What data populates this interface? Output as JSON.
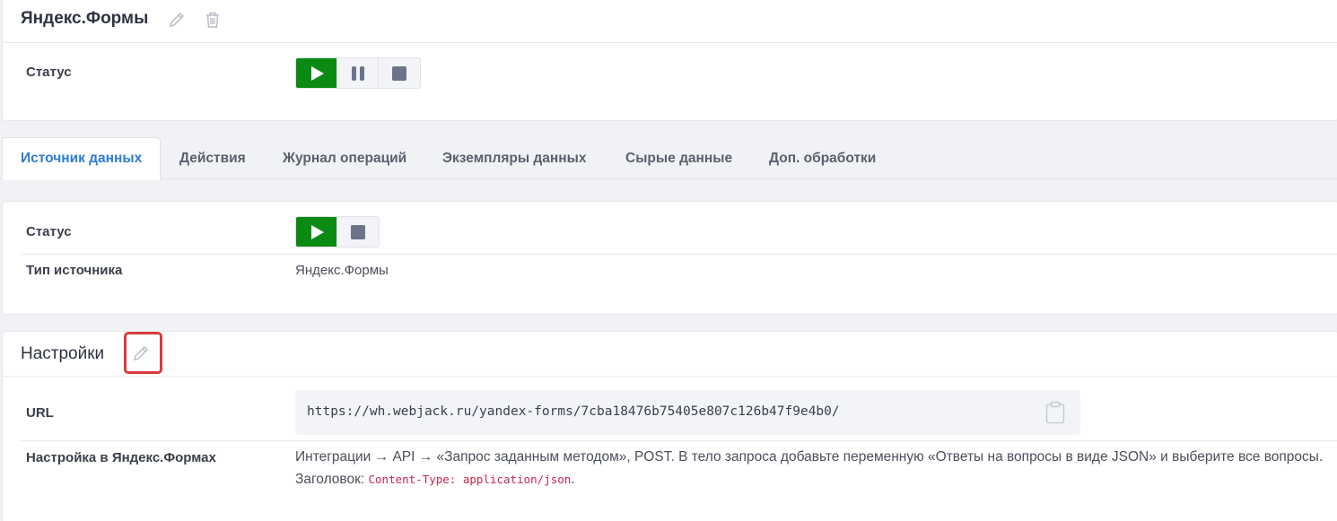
{
  "header": {
    "title": "Яндекс.Формы",
    "status_label": "Статус"
  },
  "tabs": [
    {
      "label": "Источник данных",
      "active": true
    },
    {
      "label": "Действия",
      "active": false
    },
    {
      "label": "Журнал операций",
      "active": false
    },
    {
      "label": "Экземпляры данных",
      "active": false
    },
    {
      "label": "Сырые данные",
      "active": false
    },
    {
      "label": "Доп. обработки",
      "active": false
    }
  ],
  "source": {
    "status_label": "Статус",
    "type_label": "Тип источника",
    "type_value": "Яндекс.Формы"
  },
  "settings": {
    "title": "Настройки",
    "url_label": "URL",
    "url_value": "https://wh.webjack.ru/yandex-forms/7cba18476b75405e807c126b47f9e4b0/",
    "setup_label": "Настройка в Яндекс.Формах",
    "setup_text": "Интеграции → API → «Запрос заданным методом», POST. В тело запроса добавьте переменную «Ответы на вопросы в виде JSON» и выберите все вопросы. Заголовок: ",
    "setup_code": "Content-Type: application/json",
    "setup_tail": "."
  },
  "colors": {
    "active_green": "#0b8a13",
    "active_tab": "#2e7dd1",
    "highlight_red": "#d93c3c",
    "code_pink": "#c7254e"
  },
  "icons": [
    "pencil-icon",
    "trash-icon",
    "play-icon",
    "pause-icon",
    "stop-icon",
    "clipboard-icon"
  ]
}
